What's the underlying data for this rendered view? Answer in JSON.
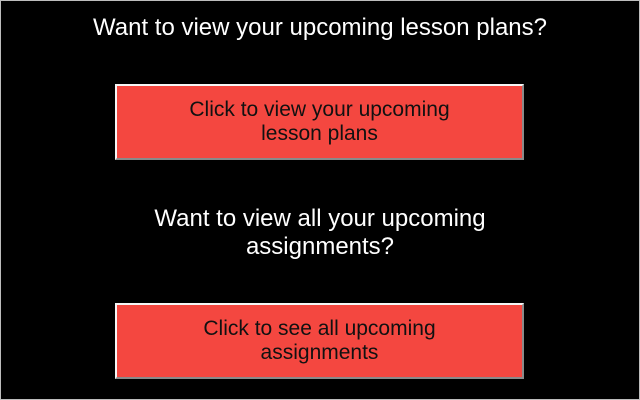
{
  "sections": [
    {
      "question_lines": [
        "Want to view your upcoming lesson plans?"
      ],
      "button_lines": [
        "Click to view your upcoming",
        "lesson plans"
      ]
    },
    {
      "question_lines": [
        "Want to view all your upcoming",
        "assignments?"
      ],
      "button_lines": [
        "Click to see all upcoming",
        "assignments"
      ]
    }
  ],
  "colors": {
    "background": "#000000",
    "text": "#ffffff",
    "button_fill": "#f44740",
    "button_text": "#111111"
  }
}
